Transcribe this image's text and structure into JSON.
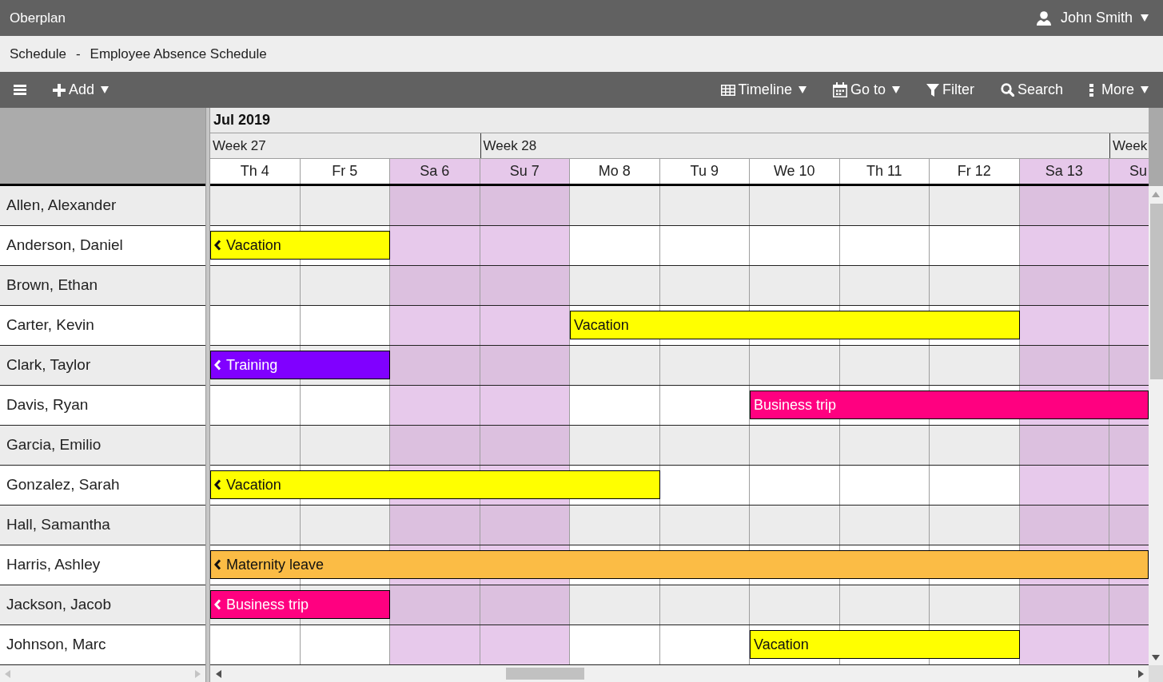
{
  "app": {
    "title": "Oberplan",
    "user": {
      "name": "John Smith",
      "dropdown": true
    }
  },
  "breadcrumb": {
    "section": "Schedule",
    "separator": "-",
    "page": "Employee Absence Schedule"
  },
  "toolbar": {
    "add": {
      "label": "Add",
      "dropdown": true
    },
    "tools": [
      {
        "label": "Timeline",
        "dropdown": true
      },
      {
        "label": "Go to",
        "dropdown": true
      },
      {
        "label": "Filter",
        "dropdown": false
      },
      {
        "label": "Search",
        "dropdown": false
      },
      {
        "label": "More",
        "dropdown": true
      }
    ]
  },
  "timeline": {
    "month": "Jul 2019",
    "weeks": [
      {
        "label": "Week 27",
        "days": [
          {
            "label": "Th 4",
            "weekend": false
          },
          {
            "label": "Fr 5",
            "weekend": false
          },
          {
            "label": "Sa 6",
            "weekend": true
          }
        ]
      },
      {
        "label": "Week 28",
        "days": [
          {
            "label": "Su 7",
            "weekend": true
          },
          {
            "label": "Mo 8",
            "weekend": false
          },
          {
            "label": "Tu 9",
            "weekend": false
          },
          {
            "label": "We 10",
            "weekend": false
          },
          {
            "label": "Th 11",
            "weekend": false
          },
          {
            "label": "Fr 12",
            "weekend": false
          },
          {
            "label": "Sa 13",
            "weekend": true
          }
        ]
      },
      {
        "label": "Week",
        "days": [
          {
            "label": "Su",
            "weekend": true
          }
        ]
      }
    ]
  },
  "employees": [
    {
      "name": "Allen, Alexander"
    },
    {
      "name": "Anderson, Daniel",
      "events": [
        {
          "label": "Vacation",
          "color": "#ffff00",
          "starts_earlier": true,
          "covers": [
            true,
            true,
            false,
            false,
            false,
            false,
            false,
            false,
            false,
            false,
            false
          ]
        }
      ]
    },
    {
      "name": "Brown, Ethan"
    },
    {
      "name": "Carter, Kevin",
      "events": [
        {
          "label": "Vacation",
          "color": "#ffff00",
          "starts_earlier": false,
          "covers": [
            false,
            false,
            false,
            false,
            true,
            true,
            true,
            true,
            true,
            false,
            false
          ]
        }
      ]
    },
    {
      "name": "Clark, Taylor",
      "events": [
        {
          "label": "Training",
          "color": "#8000ff",
          "starts_earlier": true,
          "covers": [
            true,
            true,
            false,
            false,
            false,
            false,
            false,
            false,
            false,
            false,
            false
          ]
        }
      ]
    },
    {
      "name": "Davis, Ryan",
      "events": [
        {
          "label": "Business trip",
          "color": "#ff0080",
          "starts_earlier": false,
          "covers": [
            false,
            false,
            false,
            false,
            false,
            false,
            true,
            true,
            true,
            true,
            true
          ]
        }
      ]
    },
    {
      "name": "Garcia, Emilio"
    },
    {
      "name": "Gonzalez, Sarah",
      "events": [
        {
          "label": "Vacation",
          "color": "#ffff00",
          "starts_earlier": true,
          "covers": [
            true,
            true,
            true,
            true,
            true,
            false,
            false,
            false,
            false,
            false,
            false
          ]
        }
      ]
    },
    {
      "name": "Hall, Samantha"
    },
    {
      "name": "Harris, Ashley",
      "events": [
        {
          "label": "Maternity leave",
          "color": "#fbbc45",
          "starts_earlier": true,
          "covers": [
            true,
            true,
            true,
            true,
            true,
            true,
            true,
            true,
            true,
            true,
            true
          ]
        }
      ]
    },
    {
      "name": "Jackson, Jacob",
      "events": [
        {
          "label": "Business trip",
          "color": "#ff0080",
          "starts_earlier": true,
          "covers": [
            true,
            true,
            false,
            false,
            false,
            false,
            false,
            false,
            false,
            false,
            false
          ]
        }
      ]
    },
    {
      "name": "Johnson, Marc",
      "events": [
        {
          "label": "Vacation",
          "color": "#ffff00",
          "starts_earlier": false,
          "covers": [
            false,
            false,
            false,
            false,
            false,
            false,
            true,
            true,
            true,
            false,
            false
          ]
        }
      ]
    }
  ]
}
